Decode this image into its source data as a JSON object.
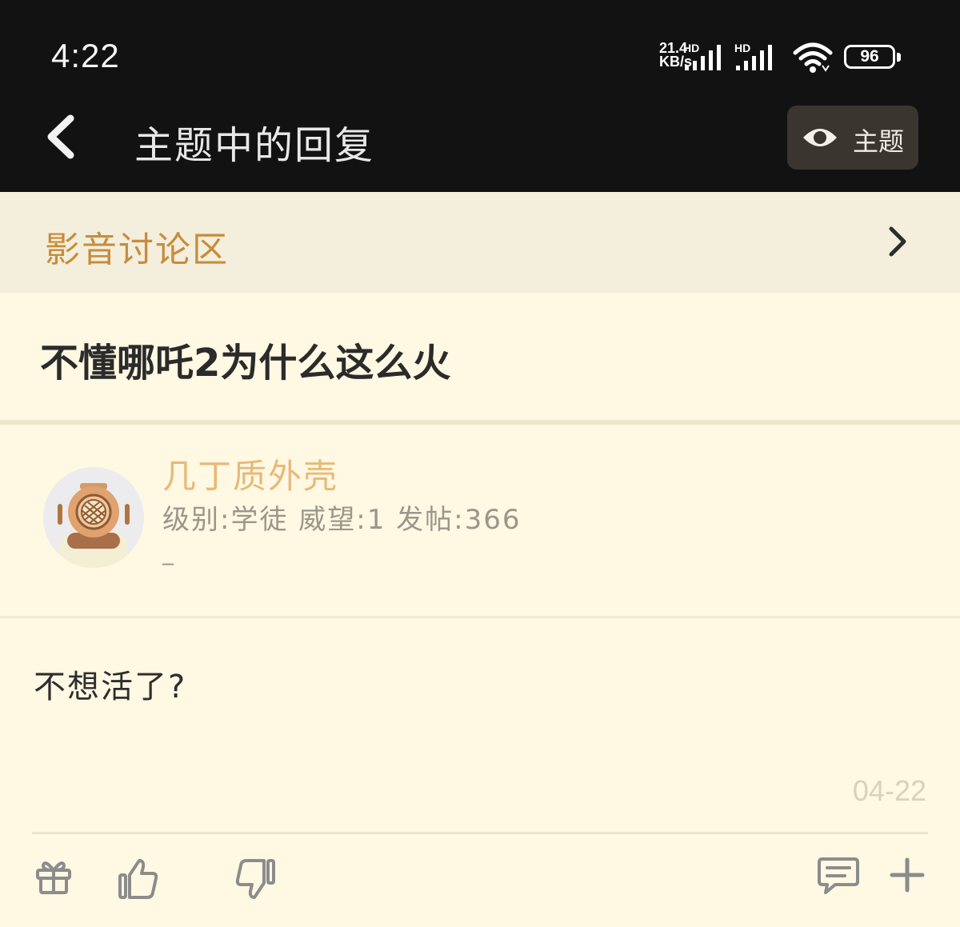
{
  "status_bar": {
    "time": "4:22",
    "net_speed_value": "21.4",
    "net_speed_unit": "KB/s",
    "signal1_label": "HD",
    "signal2_label": "HD",
    "wifi_icon": "wifi-icon",
    "battery": "96"
  },
  "app_bar": {
    "back_icon": "chevron-left-icon",
    "title": "主题中的回复",
    "topic_button_icon": "eye-icon",
    "topic_button_label": "主题"
  },
  "forum": {
    "name": "影音讨论区",
    "arrow_icon": "chevron-right-icon"
  },
  "thread": {
    "title": "不懂哪吒2为什么这么火"
  },
  "post": {
    "author": {
      "name": "几丁质外壳",
      "stats": "级别:学徒 威望:1 发帖:366",
      "signature": "_"
    },
    "body": "不想活了?",
    "date": "04-22",
    "actions": [
      "gift-icon",
      "thumbs-up-icon",
      "thumbs-down-icon",
      "comment-icon",
      "plus-icon"
    ]
  },
  "colors": {
    "background": "#fff8e3",
    "forum_bar": "#f4eedc",
    "accent": "#c58d3d",
    "username": "#e8b978",
    "header": "#121212"
  }
}
